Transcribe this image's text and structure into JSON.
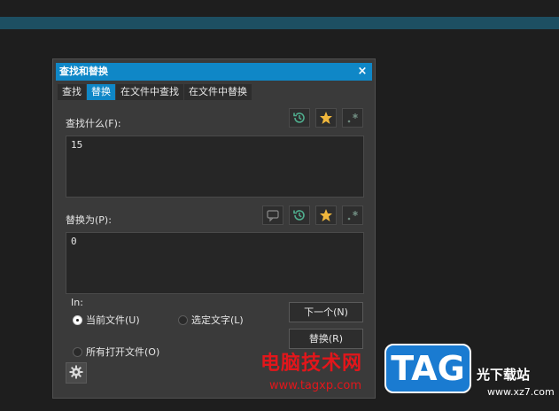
{
  "dialog": {
    "title": "查找和替换",
    "close_glyph": "×"
  },
  "tabs": [
    {
      "label": "查找",
      "active": false
    },
    {
      "label": "替换",
      "active": true
    },
    {
      "label": "在文件中查找",
      "active": false
    },
    {
      "label": "在文件中替换",
      "active": false
    }
  ],
  "find": {
    "label": "查找什么(F):",
    "value": "15",
    "icons": [
      "history-icon",
      "favorite-star-icon",
      "regex-icon"
    ]
  },
  "replace": {
    "label": "替换为(P):",
    "value": "0",
    "icons": [
      "comment-icon",
      "history-icon",
      "favorite-star-icon",
      "regex-icon"
    ]
  },
  "scope": {
    "label": "In:",
    "options": [
      {
        "label": "当前文件(U)",
        "checked": true
      },
      {
        "label": "选定文字(L)",
        "checked": false
      },
      {
        "label": "所有打开文件(O)",
        "checked": false
      }
    ]
  },
  "buttons": {
    "next": "下一个(N)",
    "replace": "替换(R)"
  },
  "watermark": {
    "cn": "电脑技术网",
    "url": "www.tagxp.com",
    "logo": "TAG",
    "site": "光下载站",
    "site_url": "www.xz7.com"
  },
  "colors": {
    "accent": "#0f87c7",
    "star": "#f0b73c",
    "history_icon": "#4fae8e",
    "watermark_red": "#e2161b"
  }
}
